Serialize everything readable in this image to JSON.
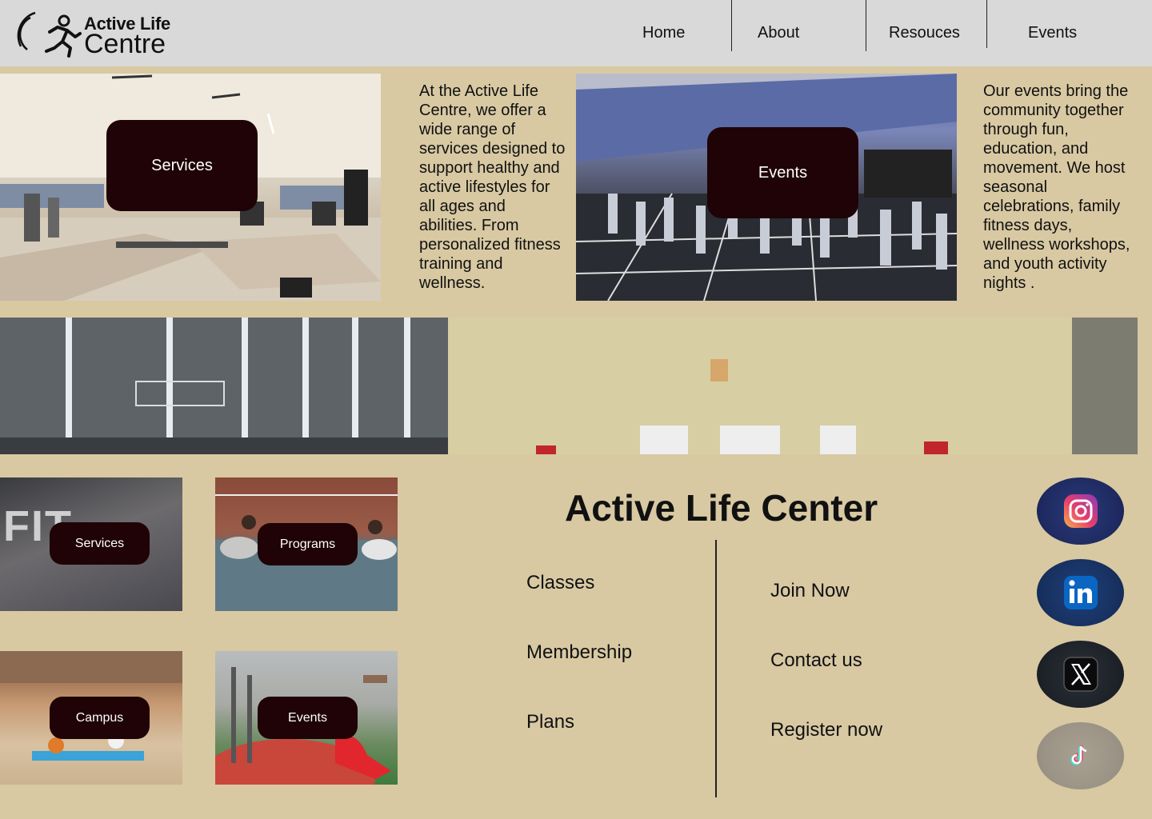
{
  "header": {
    "logo_line1": "Active Life",
    "logo_line2": "Centre",
    "nav": [
      "Home",
      "About",
      "Resouces",
      "Events"
    ]
  },
  "hero": {
    "services_label": "Services",
    "services_text": "At the Active Life Centre, we offer a wide range of services designed to support healthy and active lifestyles for all ages and abilities. From personalized fitness training and wellness.",
    "events_label": "Events",
    "events_text": "Our events bring the community together through fun, education, and movement. We host seasonal celebrations, family fitness days, wellness workshops, and youth activity nights ."
  },
  "tiles": [
    {
      "label": "Services"
    },
    {
      "label": "Programs"
    },
    {
      "label": "Campus"
    },
    {
      "label": "Events"
    }
  ],
  "footer": {
    "title": "Active Life Center",
    "left_links": [
      "Classes",
      "Membership",
      "Plans"
    ],
    "right_links": [
      "Join Now",
      "Contact us",
      "Register now"
    ],
    "social": [
      "instagram-icon",
      "linkedin-icon",
      "x-icon",
      "tiktok-icon"
    ]
  },
  "colors": {
    "background": "#d8c9a3",
    "header": "#d9d9d9",
    "pill": "#1f0306"
  }
}
